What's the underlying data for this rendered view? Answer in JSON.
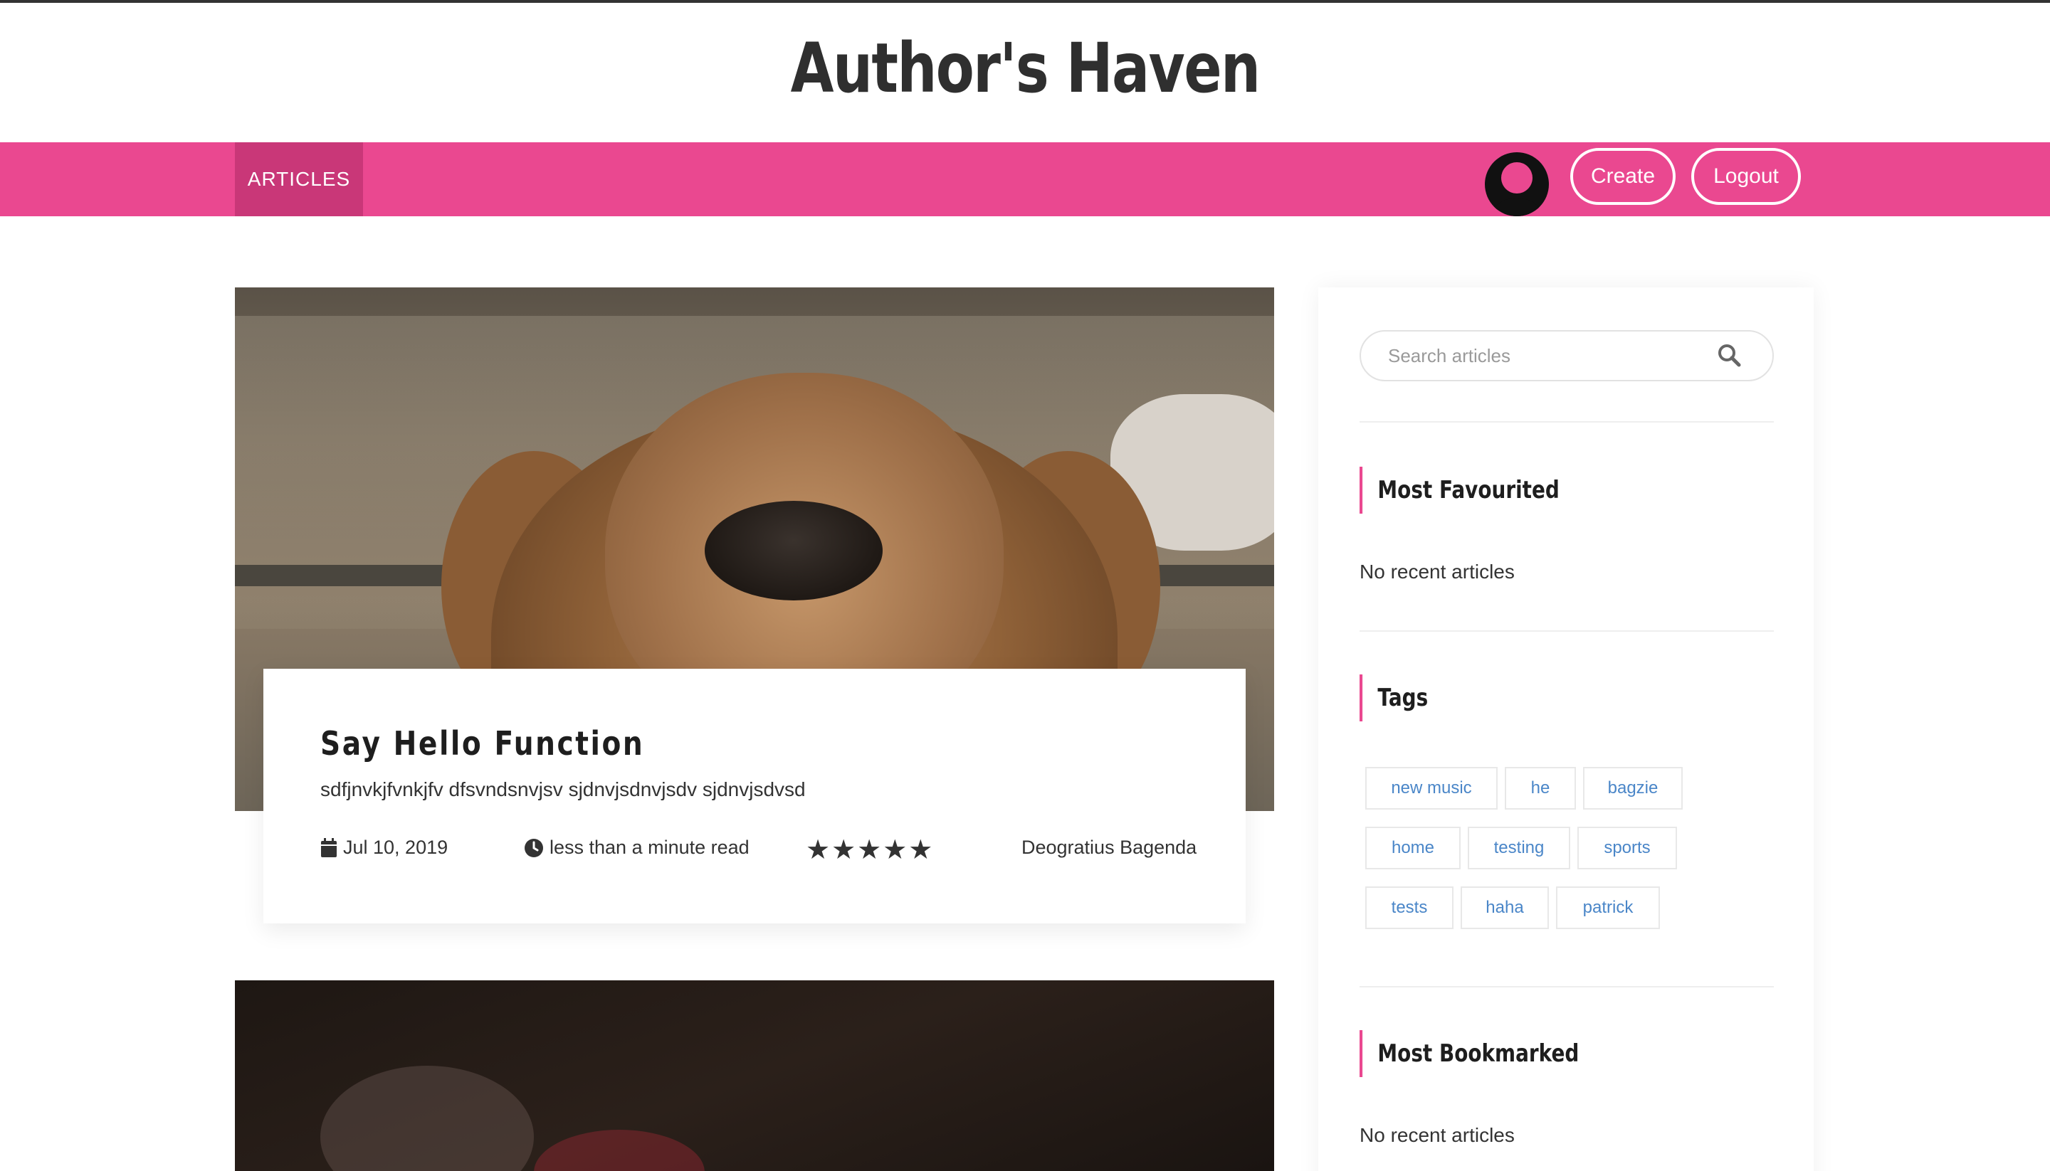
{
  "site": {
    "title": "Author's Haven"
  },
  "nav": {
    "articles_label": "ARTICLES",
    "create_label": "Create",
    "logout_label": "Logout"
  },
  "articles": [
    {
      "title": "Say Hello Function",
      "description": "sdfjnvkjfvnkjfv dfsvndsnvjsv sjdnvjsdnvjsdv sjdnvjsdvsd",
      "date": "Jul 10, 2019",
      "read_time": "less than a minute read",
      "rating_stars": "★★★★★",
      "rating": 5,
      "author": "Deogratius Bagenda"
    }
  ],
  "sidebar": {
    "search": {
      "placeholder": "Search articles",
      "value": ""
    },
    "most_favourited": {
      "heading": "Most Favourited",
      "empty_text": "No recent articles"
    },
    "tags": {
      "heading": "Tags",
      "items": [
        "new music",
        "he",
        "bagzie",
        "home",
        "testing",
        "sports",
        "tests",
        "haha",
        "patrick"
      ]
    },
    "most_bookmarked": {
      "heading": "Most Bookmarked",
      "empty_text": "No recent articles"
    }
  },
  "colors": {
    "brand_pink": "#ea4890",
    "active_nav": "#c93778",
    "tag_text": "#4a86c8"
  },
  "icons": [
    "user-avatar-icon",
    "calendar-icon",
    "clock-icon",
    "star-icon",
    "search-icon"
  ]
}
